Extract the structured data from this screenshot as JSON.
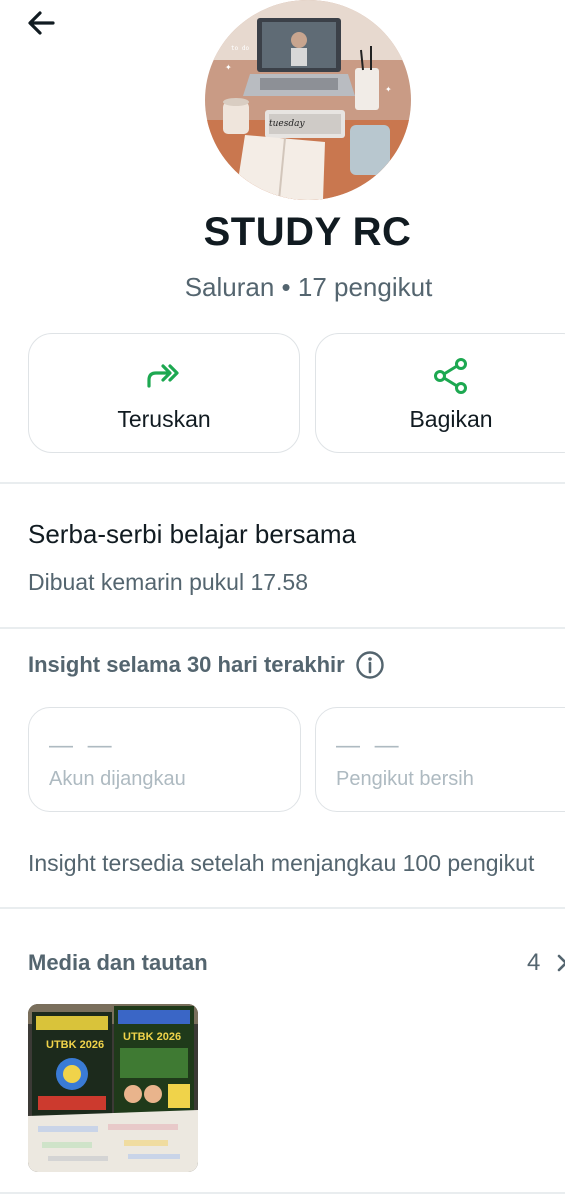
{
  "header": {
    "back_icon": "arrow-left-icon"
  },
  "channel": {
    "name": "STUDY RC",
    "meta": "Saluran • 17 pengikut"
  },
  "actions": [
    {
      "label": "Teruskan",
      "icon": "forward-icon",
      "color": "#1da851"
    },
    {
      "label": "Bagikan",
      "icon": "share-icon",
      "color": "#1da851"
    }
  ],
  "about": {
    "description": "Serba-serbi belajar bersama",
    "created": "Dibuat kemarin pukul 17.58"
  },
  "insights": {
    "title": "Insight selama 30 hari terakhir",
    "info_icon": "info-icon",
    "cards": [
      {
        "value": "— —",
        "caption": "Akun dijangkau"
      },
      {
        "value": "— —",
        "caption": "Pengikut bersih"
      }
    ],
    "note": "Insight tersedia setelah menjangkau 100 pengikut"
  },
  "media": {
    "title": "Media dan tautan",
    "count": "4",
    "chevron_icon": "chevron-right-icon",
    "thumb_texts": [
      "UTBK 2026",
      "UTBK 2026"
    ]
  },
  "colors": {
    "accent": "#1da851",
    "primary_text": "#111b21",
    "secondary_text": "#54656f",
    "muted_text": "#aebac1",
    "border": "#dfe3e6"
  }
}
